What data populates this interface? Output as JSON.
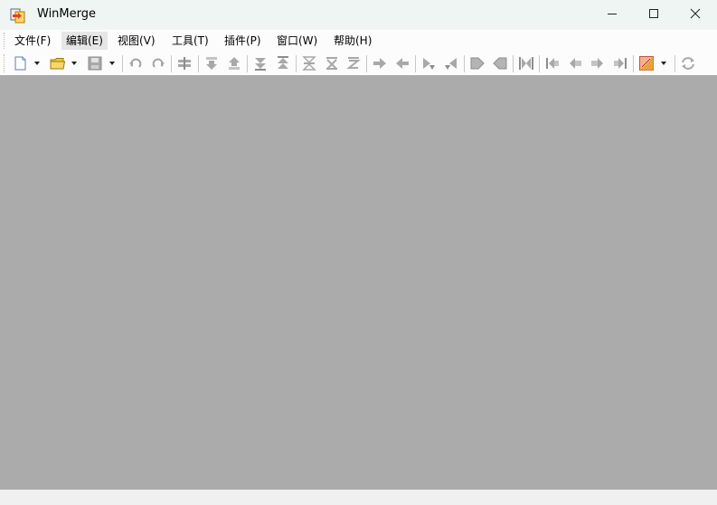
{
  "window": {
    "title": "WinMerge",
    "controls": [
      "minimize-icon",
      "maximize-icon",
      "close-icon"
    ]
  },
  "menubar": {
    "items": [
      {
        "label": "文件(F)"
      },
      {
        "label": "编辑(E)"
      },
      {
        "label": "视图(V)"
      },
      {
        "label": "工具(T)"
      },
      {
        "label": "插件(P)"
      },
      {
        "label": "窗口(W)"
      },
      {
        "label": "帮助(H)"
      }
    ]
  },
  "toolbar": {
    "buttons": [
      "new-document-icon",
      "open-folder-icon",
      "save-icon",
      "undo-icon",
      "redo-icon",
      "merge-icon",
      "next-diff-icon",
      "prev-diff-icon",
      "last-diff-icon",
      "first-diff-icon",
      "current-diff-icon",
      "next-conflict-icon",
      "prev-conflict-icon",
      "copy-right-icon",
      "copy-left-icon",
      "copy-right-advance-icon",
      "copy-left-advance-icon",
      "copy-all-right-icon",
      "copy-all-left-icon",
      "copy-all-icon",
      "first-file-icon",
      "prev-file-icon",
      "next-file-icon",
      "last-file-icon",
      "options-icon",
      "refresh-icon"
    ]
  },
  "colors": {
    "titlebar": "#eef5f3",
    "mdi_background": "#ababab",
    "menu_active": "#e6e6e6",
    "toolbar_icon_disabled": "#a8a8a8"
  }
}
